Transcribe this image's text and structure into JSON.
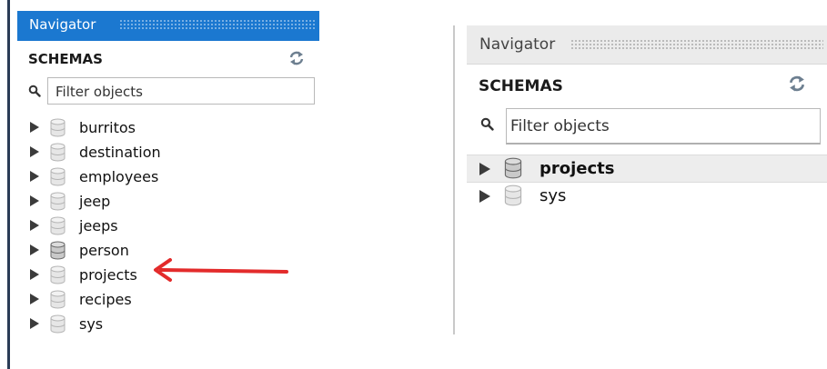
{
  "left_navigator": {
    "title": "Navigator",
    "section_title": "SCHEMAS",
    "filter_placeholder": "Filter objects",
    "schemas": [
      {
        "name": "burritos"
      },
      {
        "name": "destination"
      },
      {
        "name": "employees"
      },
      {
        "name": "jeep"
      },
      {
        "name": "jeeps"
      },
      {
        "name": "person"
      },
      {
        "name": "projects"
      },
      {
        "name": "recipes"
      },
      {
        "name": "sys"
      }
    ]
  },
  "right_navigator": {
    "title": "Navigator",
    "section_title": "SCHEMAS",
    "filter_placeholder": "Filter objects",
    "schemas": [
      {
        "name": "projects",
        "selected": true
      },
      {
        "name": "sys",
        "selected": false
      }
    ]
  },
  "annotation": {
    "arrow_color": "#e32b2b",
    "points_to": "projects"
  },
  "colors": {
    "left_header_bg": "#1b78d0",
    "right_header_bg": "#ebebeb",
    "selected_row_bg": "#ededed"
  },
  "icons": {
    "refresh": "refresh-icon",
    "search": "search-icon",
    "expand": "expand-arrow-icon",
    "schema": "database-icon"
  }
}
